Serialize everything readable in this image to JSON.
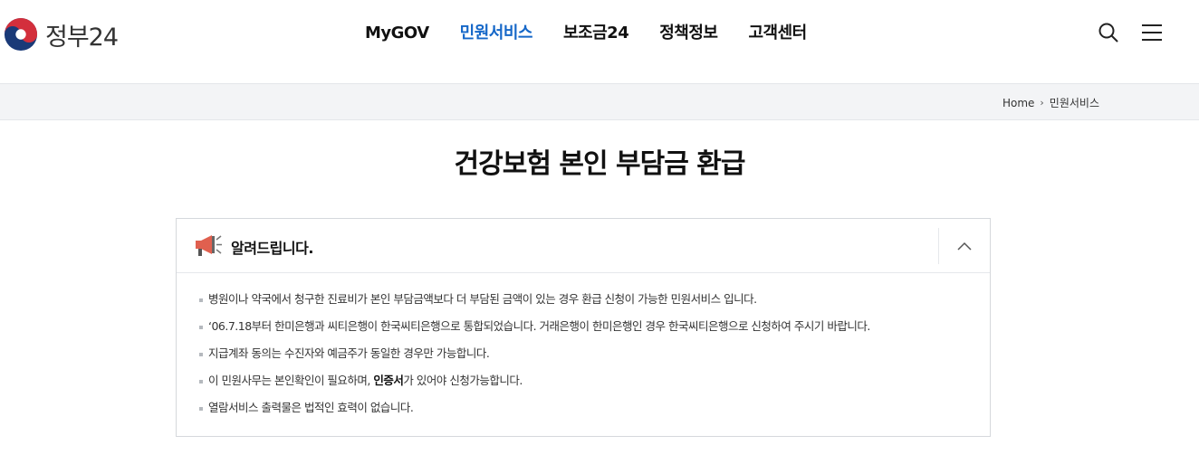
{
  "header": {
    "logo_text": "정부24",
    "nav": [
      {
        "label": "MyGOV",
        "active": false
      },
      {
        "label": "민원서비스",
        "active": true
      },
      {
        "label": "보조금24",
        "active": false
      },
      {
        "label": "정책정보",
        "active": false
      },
      {
        "label": "고객센터",
        "active": false
      }
    ],
    "search_icon": "search-icon",
    "menu_icon": "hamburger-menu-icon",
    "accent_color": "#1567c8"
  },
  "breadcrumb": {
    "home": "Home",
    "current": "민원서비스"
  },
  "page_title": "건강보험 본인 부담금 환급",
  "notice": {
    "title": "알려드립니다.",
    "icon": "megaphone-icon",
    "toggle_icon": "chevron-up-icon",
    "items": [
      {
        "text": "병원이나 약국에서 청구한 진료비가 본인 부담금액보다 더 부담된 금액이 있는 경우 환급 신청이 가능한 민원서비스 입니다."
      },
      {
        "text": "‘06.7.18부터 한미은행과 씨티은행이 한국씨티은행으로 통합되었습니다. 거래은행이 한미은행인 경우 한국씨티은행으로 신청하여 주시기 바랍니다."
      },
      {
        "text": "지급계좌 동의는 수진자와 예금주가 동일한 경우만 가능합니다."
      },
      {
        "pre": "이 민원사무는 본인확인이 필요하며, ",
        "bold": "인증서",
        "post": "가 있어야 신청가능합니다."
      },
      {
        "text": "열람서비스 출력물은 법적인 효력이 없습니다."
      }
    ]
  }
}
